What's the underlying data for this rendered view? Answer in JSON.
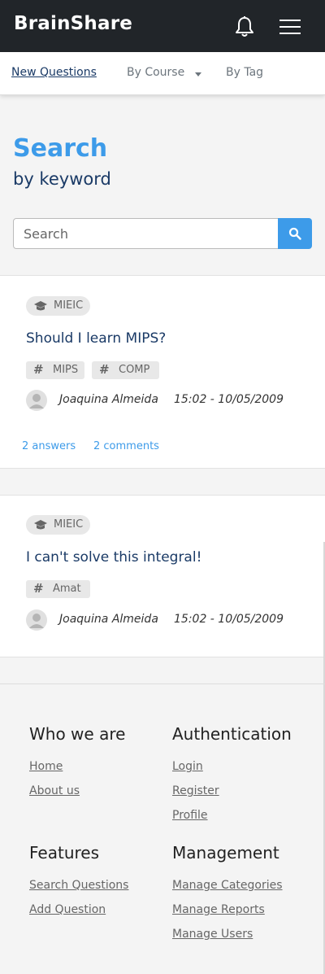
{
  "brand": "BrainShare",
  "subnav": {
    "new_questions": "New Questions",
    "by_course": "By Course",
    "by_tag": "By Tag"
  },
  "search": {
    "title": "Search",
    "subtitle": "by keyword",
    "placeholder": "Search"
  },
  "questions": [
    {
      "course": "MIEIC",
      "title": "Should I learn MIPS?",
      "tags": [
        "MIPS",
        "COMP"
      ],
      "author": "Joaquina Almeida",
      "date": "15:02 - 10/05/2009",
      "answers": "2 answers",
      "comments": "2 comments"
    },
    {
      "course": "MIEIC",
      "title": "I can't solve this integral!",
      "tags": [
        "Amat"
      ],
      "author": "Joaquina Almeida",
      "date": "15:02 - 10/05/2009"
    }
  ],
  "footer": {
    "who_title": "Who we are",
    "who_links": [
      "Home",
      "About us"
    ],
    "auth_title": "Authentication",
    "auth_links": [
      "Login",
      "Register",
      "Profile"
    ],
    "features_title": "Features",
    "features_links": [
      "Search Questions",
      "Add Question"
    ],
    "management_title": "Management",
    "management_links": [
      "Manage Categories",
      "Manage Reports",
      "Manage Users"
    ]
  },
  "colors": {
    "accent": "#3d9be9",
    "navbar": "#212529",
    "heading": "#1a3a66"
  },
  "icons": [
    "bell-icon",
    "menu-icon",
    "search-icon",
    "graduation-cap-icon",
    "hash-icon",
    "user-avatar-icon"
  ]
}
